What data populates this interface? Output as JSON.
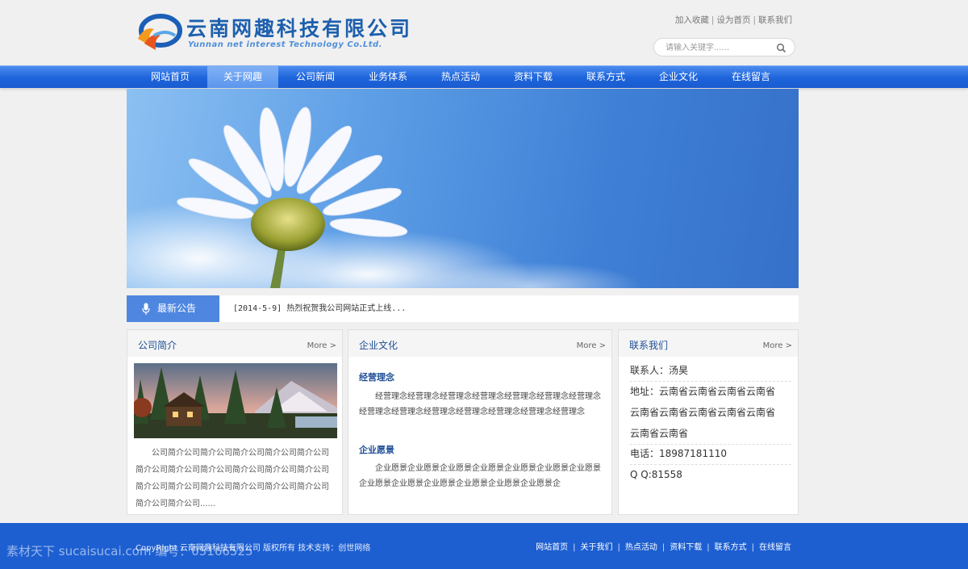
{
  "header": {
    "logo_title": "云南网趣科技有限公司",
    "logo_sub": "Yunnan net interest Technology Co.Ltd.",
    "toplinks": [
      "加入收藏",
      "设为首页",
      "联系我们"
    ],
    "search_placeholder": "请输入关键字......"
  },
  "nav": {
    "items": [
      "网站首页",
      "关于网趣",
      "公司新闻",
      "业务体系",
      "热点活动",
      "资料下载",
      "联系方式",
      "企业文化",
      "在线留言"
    ],
    "active_index": 1
  },
  "notice": {
    "label": "最新公告",
    "text": "[2014-5-9] 热烈祝贺我公司网站正式上线..."
  },
  "panels": {
    "intro": {
      "title": "公司简介",
      "more": "More >",
      "text": "公司简介公司简介公司简介公司简介公司简介公司简介公司简介公司简介公司简介公司简介公司简介公司简介公司简介公司简介公司简介公司简介公司简介公司简介公司简介公司......"
    },
    "culture": {
      "title": "企业文化",
      "more": "More >",
      "heading1": "经营理念",
      "text1": "经营理念经营理念经营理念经营理念经营理念经营理念经营理念经营理念经营理念经营理念经营理念经营理念经营理念经营理念",
      "heading2": "企业愿景",
      "text2": "企业愿景企业愿景企业愿景企业愿景企业愿景企业愿景企业愿景企业愿景企业愿景企业愿景企业愿景企业愿景企业愿景企"
    },
    "contact": {
      "title": "联系我们",
      "more": "More >",
      "person": "联系人：汤昊",
      "address1": "地址：云南省云南省云南省云南省",
      "address2": "云南省云南省云南省云南省云南省",
      "address3": "云南省云南省",
      "phone": "电话：18987181110",
      "qq": "Q Q:81558"
    }
  },
  "footer": {
    "copyright": "CopyRight 云南网趣科技有限公司 版权所有  技术支持：创世网络",
    "links": [
      "网站首页",
      "关于我们",
      "热点活动",
      "资料下载",
      "联系方式",
      "在线留言"
    ],
    "watermark": "素材天下 sucaisucai.com  编号：05166525"
  },
  "colors": {
    "brand_blue": "#1d5fd1",
    "nav_active": "#5b96ee",
    "title_blue": "#1f4e96"
  }
}
